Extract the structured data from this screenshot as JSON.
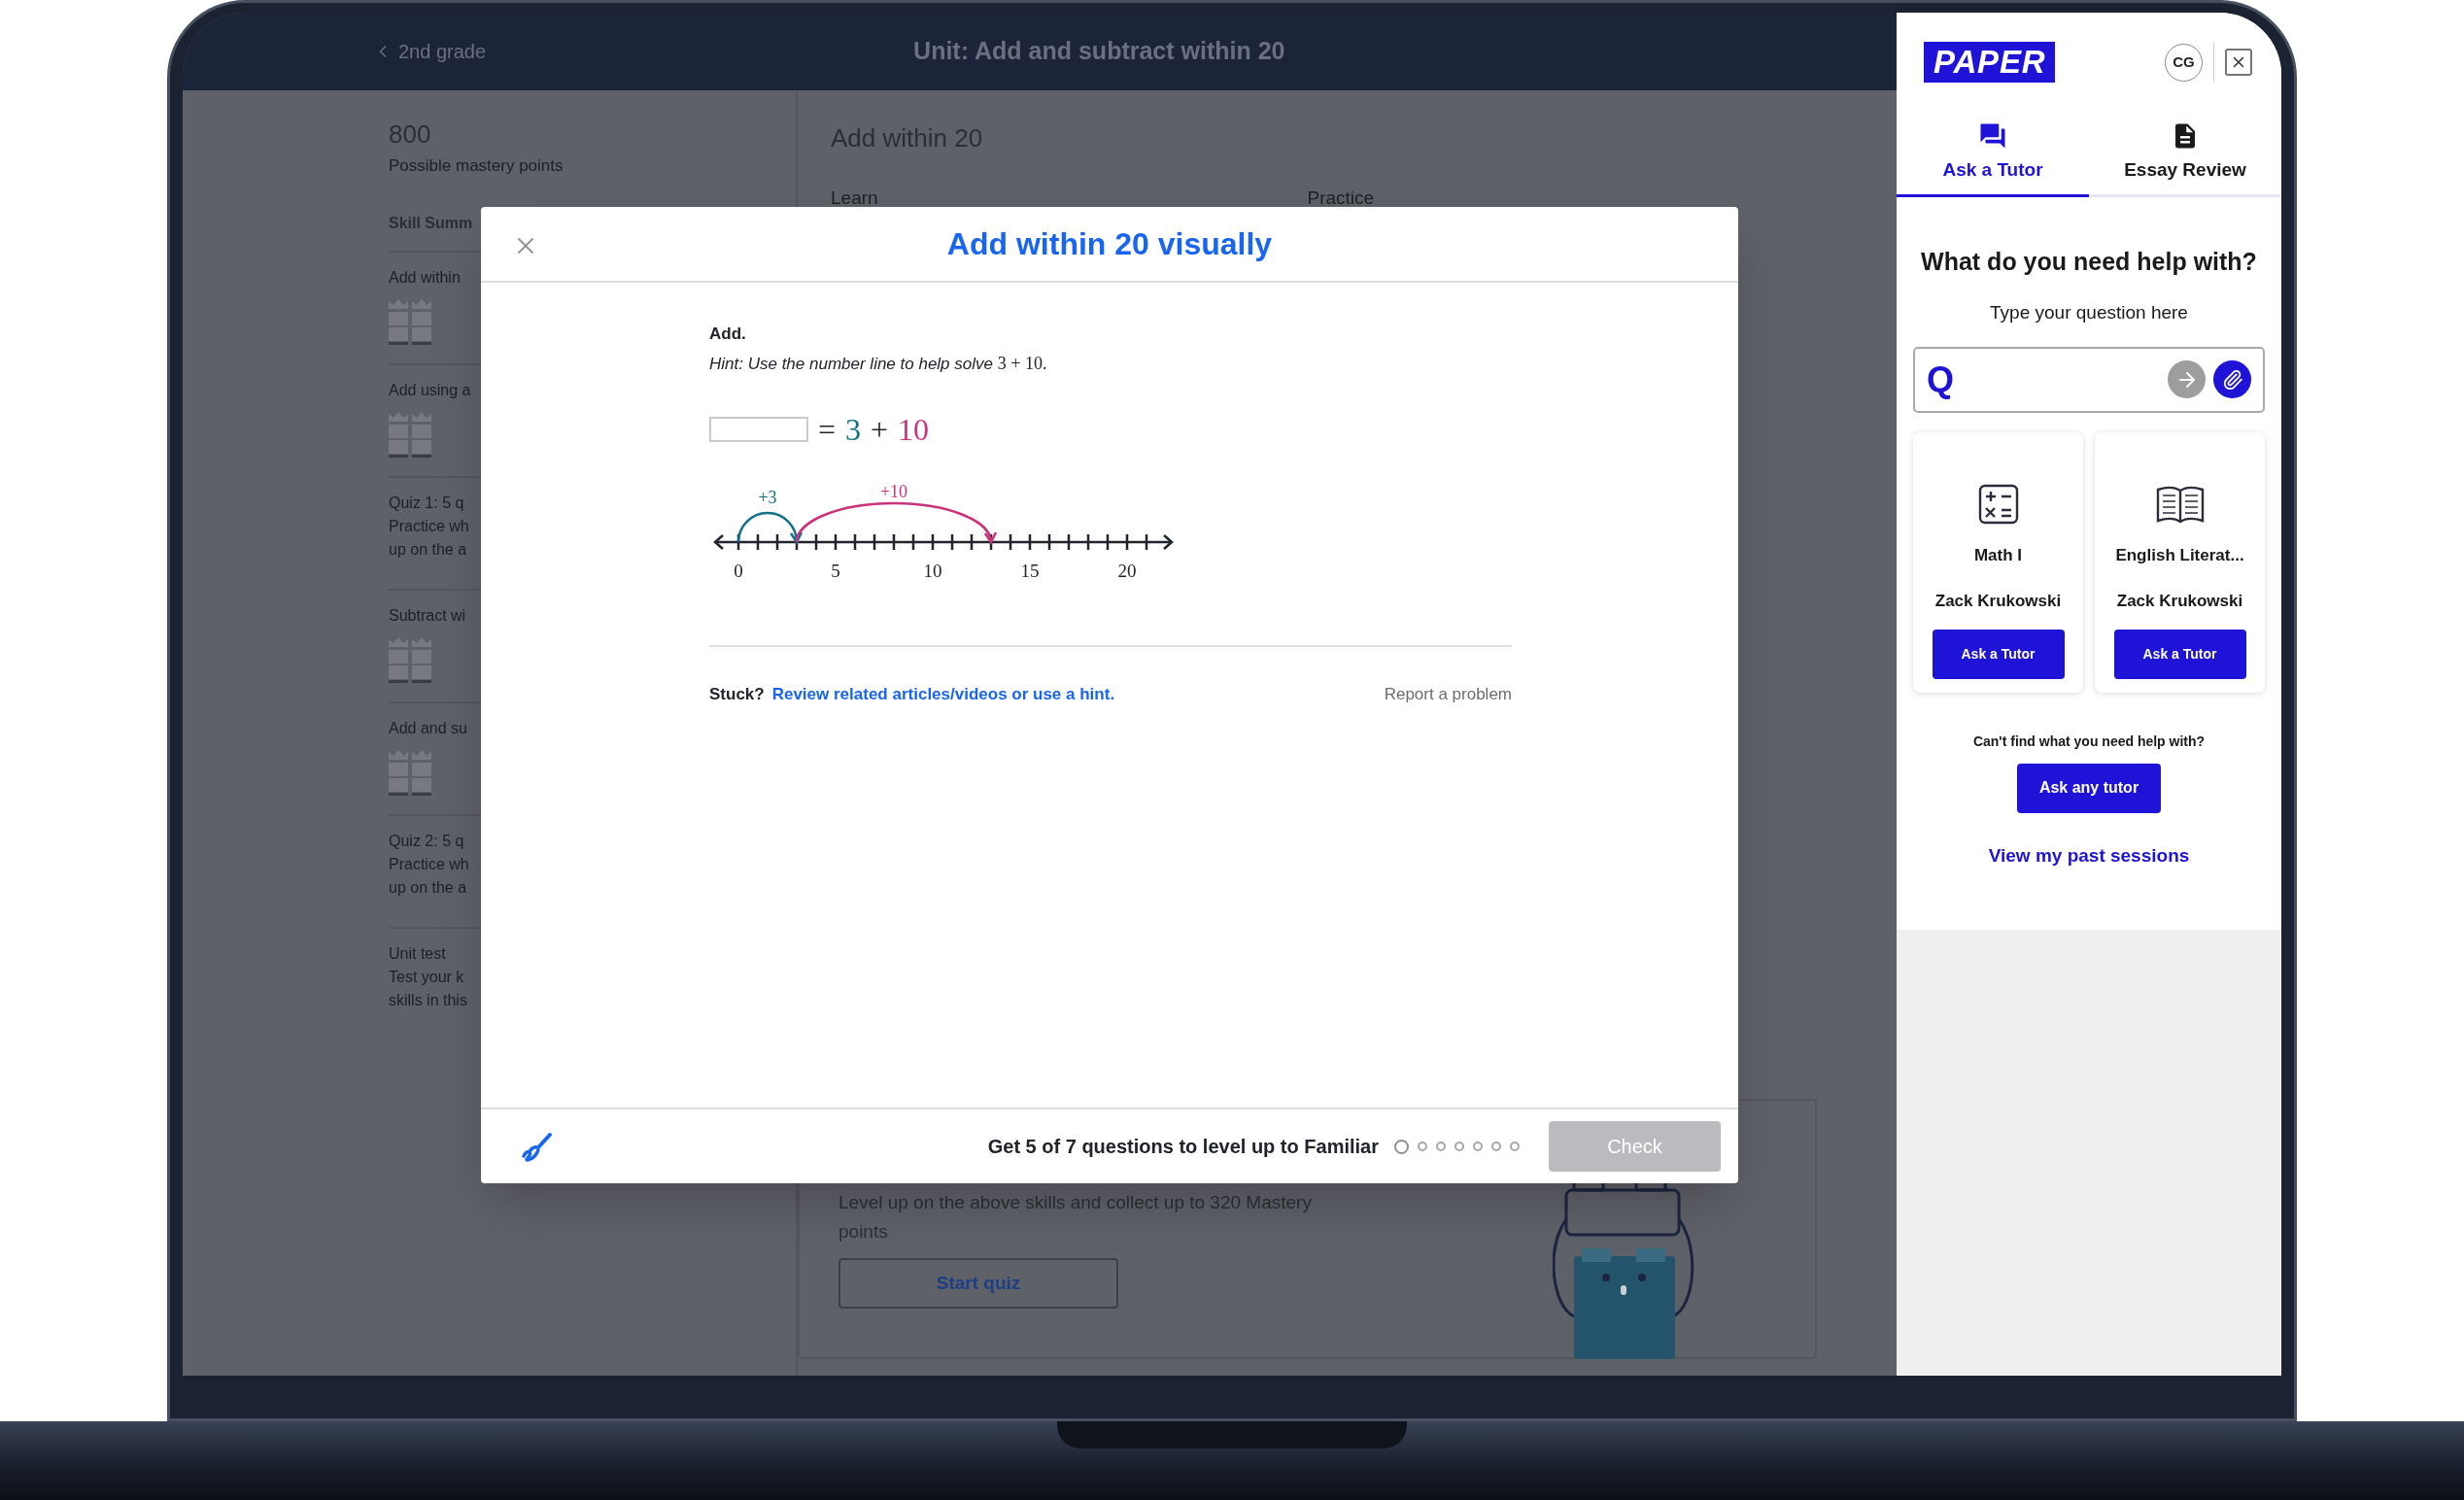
{
  "header": {
    "back_label": "2nd grade",
    "title": "Unit: Add and subtract within 20"
  },
  "sidebar": {
    "points": "800",
    "points_caption": "Possible mastery points",
    "section_title": "Skill Summ",
    "items": [
      {
        "kind": "skill",
        "title": "Add within"
      },
      {
        "kind": "skill",
        "title": "Add using a"
      },
      {
        "kind": "quiz",
        "title": "Quiz 1: 5 q",
        "lines": [
          "Practice wh",
          "up on the a"
        ]
      },
      {
        "kind": "skill",
        "title": "Subtract wi"
      },
      {
        "kind": "skill",
        "title": "Add and su"
      },
      {
        "kind": "quiz",
        "title": "Quiz 2: 5 q",
        "lines": [
          "Practice wh",
          "up on the a"
        ]
      },
      {
        "kind": "quiz",
        "title": "Unit test",
        "lines": [
          "Test your k",
          "skills in this"
        ]
      }
    ]
  },
  "lesson": {
    "title": "Add within 20",
    "tabs": [
      "Learn",
      "Practice"
    ],
    "quiz_text_lines": [
      "Level up on the above skills and collect up to 320 Mastery",
      "points"
    ],
    "quiz_button": "Start quiz"
  },
  "modal": {
    "title": "Add within 20 visually",
    "instruction": "Add.",
    "hint": "Hint: Use the number line to help solve",
    "hint_math": "3 + 10.",
    "equation": {
      "equals": "=",
      "plus": "+",
      "addend_a": {
        "text": "3",
        "color": "#11708a"
      },
      "addend_b": {
        "text": "10",
        "color": "#ca337c"
      }
    },
    "number_line": {
      "tick_labels": [
        "0",
        "5",
        "10",
        "15",
        "20"
      ],
      "jumps": [
        {
          "label": "+3",
          "color": "#11708a"
        },
        {
          "label": "+10",
          "color": "#ca337c"
        }
      ]
    },
    "footer": {
      "stuck": "Stuck?",
      "link": "Review related articles/videos or use a hint.",
      "report": "Report a problem"
    },
    "bottom_bar": {
      "goal": "Get 5 of 7 questions to level up to Familiar",
      "dots": [
        {
          "current": true
        },
        {
          "current": false
        },
        {
          "current": false
        },
        {
          "current": false
        },
        {
          "current": false
        },
        {
          "current": false
        },
        {
          "current": false
        }
      ],
      "check_button": {
        "label": "Check",
        "disabled": true
      }
    }
  },
  "panel": {
    "logo": "PAPER",
    "avatar": "CG",
    "tabs": [
      {
        "label": "Ask a Tutor",
        "selected": true
      },
      {
        "label": "Essay Review",
        "selected": false
      }
    ],
    "heading": "What do you need help with?",
    "subheading": "Type your question here",
    "input": {
      "prefix": "Q",
      "send_disabled": true
    },
    "subjects": [
      {
        "name": "Math I",
        "tutor": "Zack Krukowski",
        "button": "Ask a Tutor"
      },
      {
        "name": "English Literat...",
        "tutor": "Zack Krukowski",
        "button": "Ask a Tutor"
      }
    ],
    "help_text": "Can't find what you need help with?",
    "any_tutor_button": "Ask any tutor",
    "past_sessions_link": "View my past sessions"
  }
}
